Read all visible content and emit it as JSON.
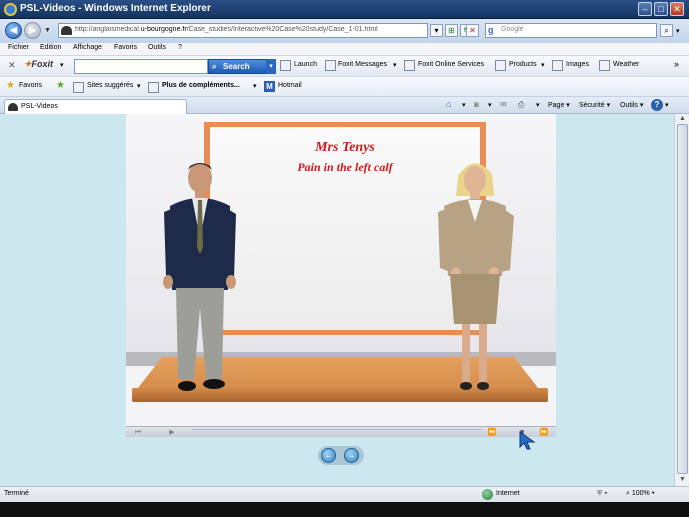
{
  "window": {
    "title": "PSL-Videos - Windows Internet Explorer"
  },
  "address_bar": {
    "url_prefix": "http://anglaismedical.",
    "url_domain": "u-bourgogne.fr",
    "url_suffix": "/Case_studies/Interactive%20Case%20study/Case_1-01.html",
    "search_placeholder": "Google"
  },
  "menu": {
    "items": [
      "Fichier",
      "Edition",
      "Affichage",
      "Favoris",
      "Outils",
      "?"
    ]
  },
  "foxit_toolbar": {
    "brand": "Foxit",
    "search_label": "Search",
    "items": [
      "Launch",
      "Foxit Messages",
      "Foxit Online Services",
      "Products",
      "Images",
      "Weather"
    ]
  },
  "favorites_bar": {
    "favorites_label": "Favoris",
    "suggested_sites": "Sites suggérés",
    "more_addons": "Plus de compléments...",
    "hotmail": "Hotmail"
  },
  "tab": {
    "label": "PSL-Videos"
  },
  "command_bar": {
    "page_label": "Page",
    "security_label": "Sécurité",
    "tools_label": "Outils"
  },
  "video": {
    "board_title": "Mrs Tenys",
    "board_subtitle": "Pain in the left calf"
  },
  "status_bar": {
    "status_text": "Terminé",
    "zone": "Internet",
    "zoom": "100%"
  },
  "colors": {
    "title_bar": "#1d3f70",
    "content_bg": "#cde7ef",
    "board_frame": "#e98d57",
    "board_text": "#d2191b"
  }
}
